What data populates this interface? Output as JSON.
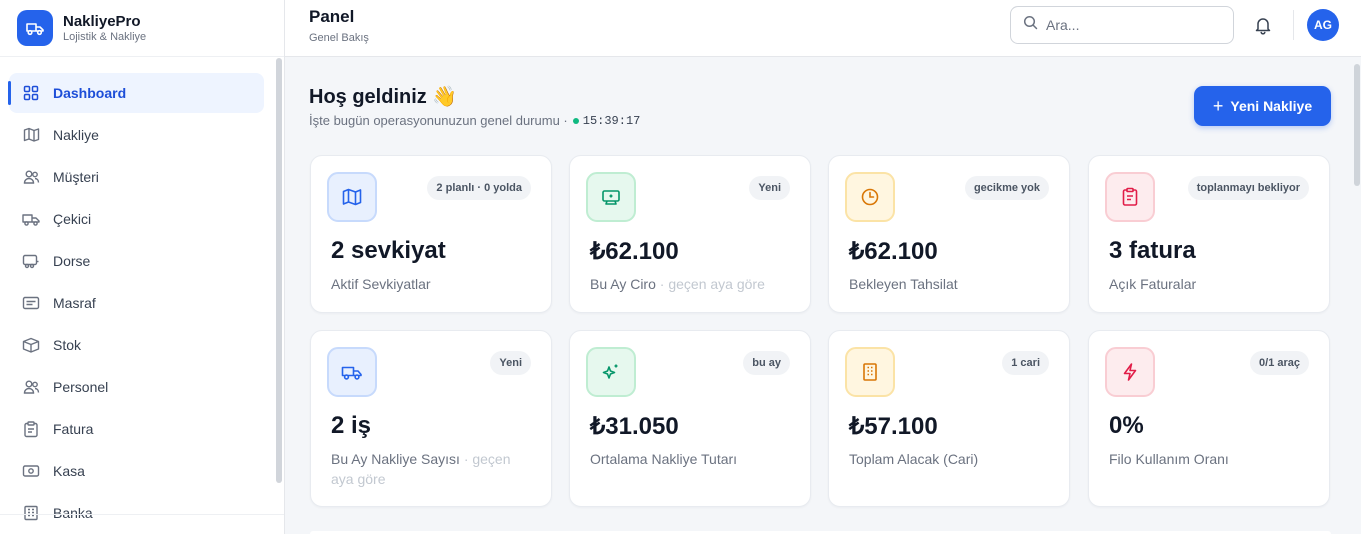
{
  "brand": {
    "name": "NakliyePro",
    "subtitle": "Lojistik & Nakliye"
  },
  "sidebar": {
    "items": [
      {
        "label": "Dashboard",
        "icon": "grid-icon",
        "active": true
      },
      {
        "label": "Nakliye",
        "icon": "map-icon"
      },
      {
        "label": "Müşteri",
        "icon": "users-icon"
      },
      {
        "label": "Çekici",
        "icon": "truck-icon"
      },
      {
        "label": "Dorse",
        "icon": "trailer-icon"
      },
      {
        "label": "Masraf",
        "icon": "receipt-icon"
      },
      {
        "label": "Stok",
        "icon": "box-icon"
      },
      {
        "label": "Personel",
        "icon": "people-icon"
      },
      {
        "label": "Fatura",
        "icon": "invoice-icon"
      },
      {
        "label": "Kasa",
        "icon": "cash-icon"
      },
      {
        "label": "Banka",
        "icon": "bank-icon"
      }
    ]
  },
  "header": {
    "title": "Panel",
    "subtitle": "Genel Bakış",
    "search_placeholder": "Ara...",
    "avatar_initials": "AG"
  },
  "main": {
    "welcome": "Hoş geldiniz 👋",
    "subline": "İşte bugün operasyonunuzun genel durumu ·",
    "time": "15:39:17",
    "new_button": "Yeni Nakliye",
    "cards": [
      {
        "value": "2 sevkiyat",
        "label": "Aktif Sevkiyatlar",
        "badge": "2 planlı · 0 yolda",
        "icon": "map-icon",
        "color": "blue"
      },
      {
        "value": "₺62.100",
        "label": "Bu Ay Ciro",
        "label_suffix": "· geçen aya göre",
        "badge": "Yeni",
        "icon": "money-icon",
        "color": "green"
      },
      {
        "value": "₺62.100",
        "label": "Bekleyen Tahsilat",
        "badge": "gecikme yok",
        "icon": "clock-icon",
        "color": "amber"
      },
      {
        "value": "3 fatura",
        "label": "Açık Faturalar",
        "badge": "toplanmayı bekliyor",
        "icon": "invoice-icon",
        "color": "red"
      },
      {
        "value": "2 iş",
        "label": "Bu Ay Nakliye Sayısı",
        "label_suffix": "· geçen aya göre",
        "badge": "Yeni",
        "icon": "truck-icon",
        "color": "blue"
      },
      {
        "value": "₺31.050",
        "label": "Ortalama Nakliye Tutarı",
        "badge": "bu ay",
        "icon": "sparkle-icon",
        "color": "green"
      },
      {
        "value": "₺57.100",
        "label": "Toplam Alacak (Cari)",
        "badge": "1 cari",
        "icon": "building-icon",
        "color": "amber"
      },
      {
        "value": "0%",
        "label": "Filo Kullanım Oranı",
        "badge": "0/1 araç",
        "icon": "bolt-icon",
        "color": "red"
      }
    ]
  },
  "colors": {
    "accent": "#2563eb",
    "green": "#10b981",
    "amber": "#d97706",
    "red": "#e11d48"
  }
}
